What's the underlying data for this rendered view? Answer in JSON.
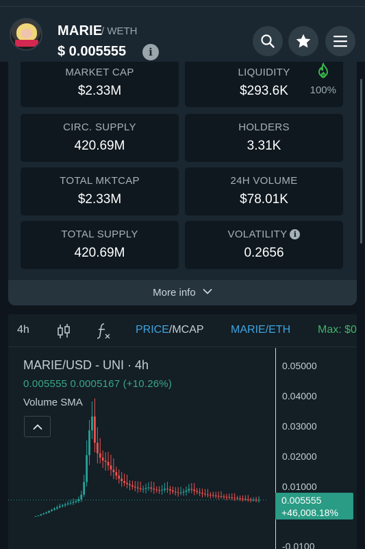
{
  "header": {
    "token_name": "MARIE",
    "pair_suffix": "/ WETH",
    "price": "$ 0.005555",
    "info_glyph": "i",
    "avatar_icon": "token-avatar-icon",
    "buttons": [
      "search-icon",
      "star-icon",
      "menu-icon"
    ]
  },
  "stats": {
    "market_cap": {
      "label": "MARKET CAP",
      "value": "$2.33M"
    },
    "liquidity": {
      "label": "LIQUIDITY",
      "value": "$293.6K",
      "percent": "100%",
      "icon": "flame-icon",
      "icon_color": "#39b54a"
    },
    "circ_supply": {
      "label": "CIRC. SUPPLY",
      "value": "420.69M"
    },
    "holders": {
      "label": "HOLDERS",
      "value": "3.31K"
    },
    "total_mktcap": {
      "label": "TOTAL MKTCAP",
      "value": "$2.33M"
    },
    "volume_24h": {
      "label": "24H VOLUME",
      "value": "$78.01K"
    },
    "total_supply": {
      "label": "TOTAL SUPPLY",
      "value": "420.69M"
    },
    "volatility": {
      "label": "VOLATILITY",
      "value": "0.2656",
      "info_glyph": "i"
    },
    "more_info": "More info"
  },
  "chart_toolbar": {
    "interval": "4h",
    "price_mode": "PRICE",
    "mcap_mode": "/MCAP",
    "pair_toggle": "MARIE/ETH",
    "max_label": "Max: $0"
  },
  "chart": {
    "title": "MARIE/USD - UNI · 4h",
    "ohlc": "0.005555  0.0005167 (+10.26%)",
    "volume_label": "Volume SMA",
    "price_tag_value": "0.005555",
    "price_tag_change": "+46,008.18%",
    "y_ticks": [
      "0.05000",
      "0.04000",
      "0.03000",
      "0.02000",
      "0.01000",
      "-0.0100"
    ],
    "colors": {
      "up": "#26a69a",
      "down": "#ef5350",
      "link": "#3fa5e0",
      "positive": "#3aa887"
    }
  },
  "chart_data": {
    "type": "line",
    "title": "MARIE/USD - UNI · 4h",
    "y_ticks": [
      0.05,
      0.04,
      0.03,
      0.02,
      0.01,
      -0.01
    ],
    "ylim": [
      -0.012,
      0.055
    ],
    "series": [
      {
        "name": "MARIE/USD",
        "values": [
          0.0002,
          0.0004,
          0.0008,
          0.0011,
          0.0014,
          0.0019,
          0.0023,
          0.0027,
          0.0031,
          0.0035,
          0.0038,
          0.0041,
          0.0044,
          0.0046,
          0.0049,
          0.0052,
          0.0058,
          0.0073,
          0.0115,
          0.0204,
          0.0286,
          0.0332,
          0.0245,
          0.021,
          0.0196,
          0.0186,
          0.0182,
          0.017,
          0.0156,
          0.0148,
          0.0136,
          0.0126,
          0.0118,
          0.0112,
          0.0108,
          0.0104,
          0.01,
          0.0097,
          0.0094,
          0.0091,
          0.0092,
          0.0095,
          0.0097,
          0.0093,
          0.009,
          0.0088,
          0.0087,
          0.0089,
          0.0093,
          0.0091,
          0.0087,
          0.0083,
          0.0081,
          0.0079,
          0.008,
          0.0083,
          0.0087,
          0.0092,
          0.009,
          0.0085,
          0.0082,
          0.0079,
          0.0076,
          0.0074,
          0.0073,
          0.0072,
          0.007,
          0.0069,
          0.0068,
          0.0067,
          0.0066,
          0.0065,
          0.0064,
          0.0063,
          0.0062,
          0.0061,
          0.006,
          0.0059,
          0.0058,
          0.0057,
          0.0056,
          0.0056,
          0.0055,
          0.0056
        ]
      }
    ],
    "last_price": 0.005555
  }
}
